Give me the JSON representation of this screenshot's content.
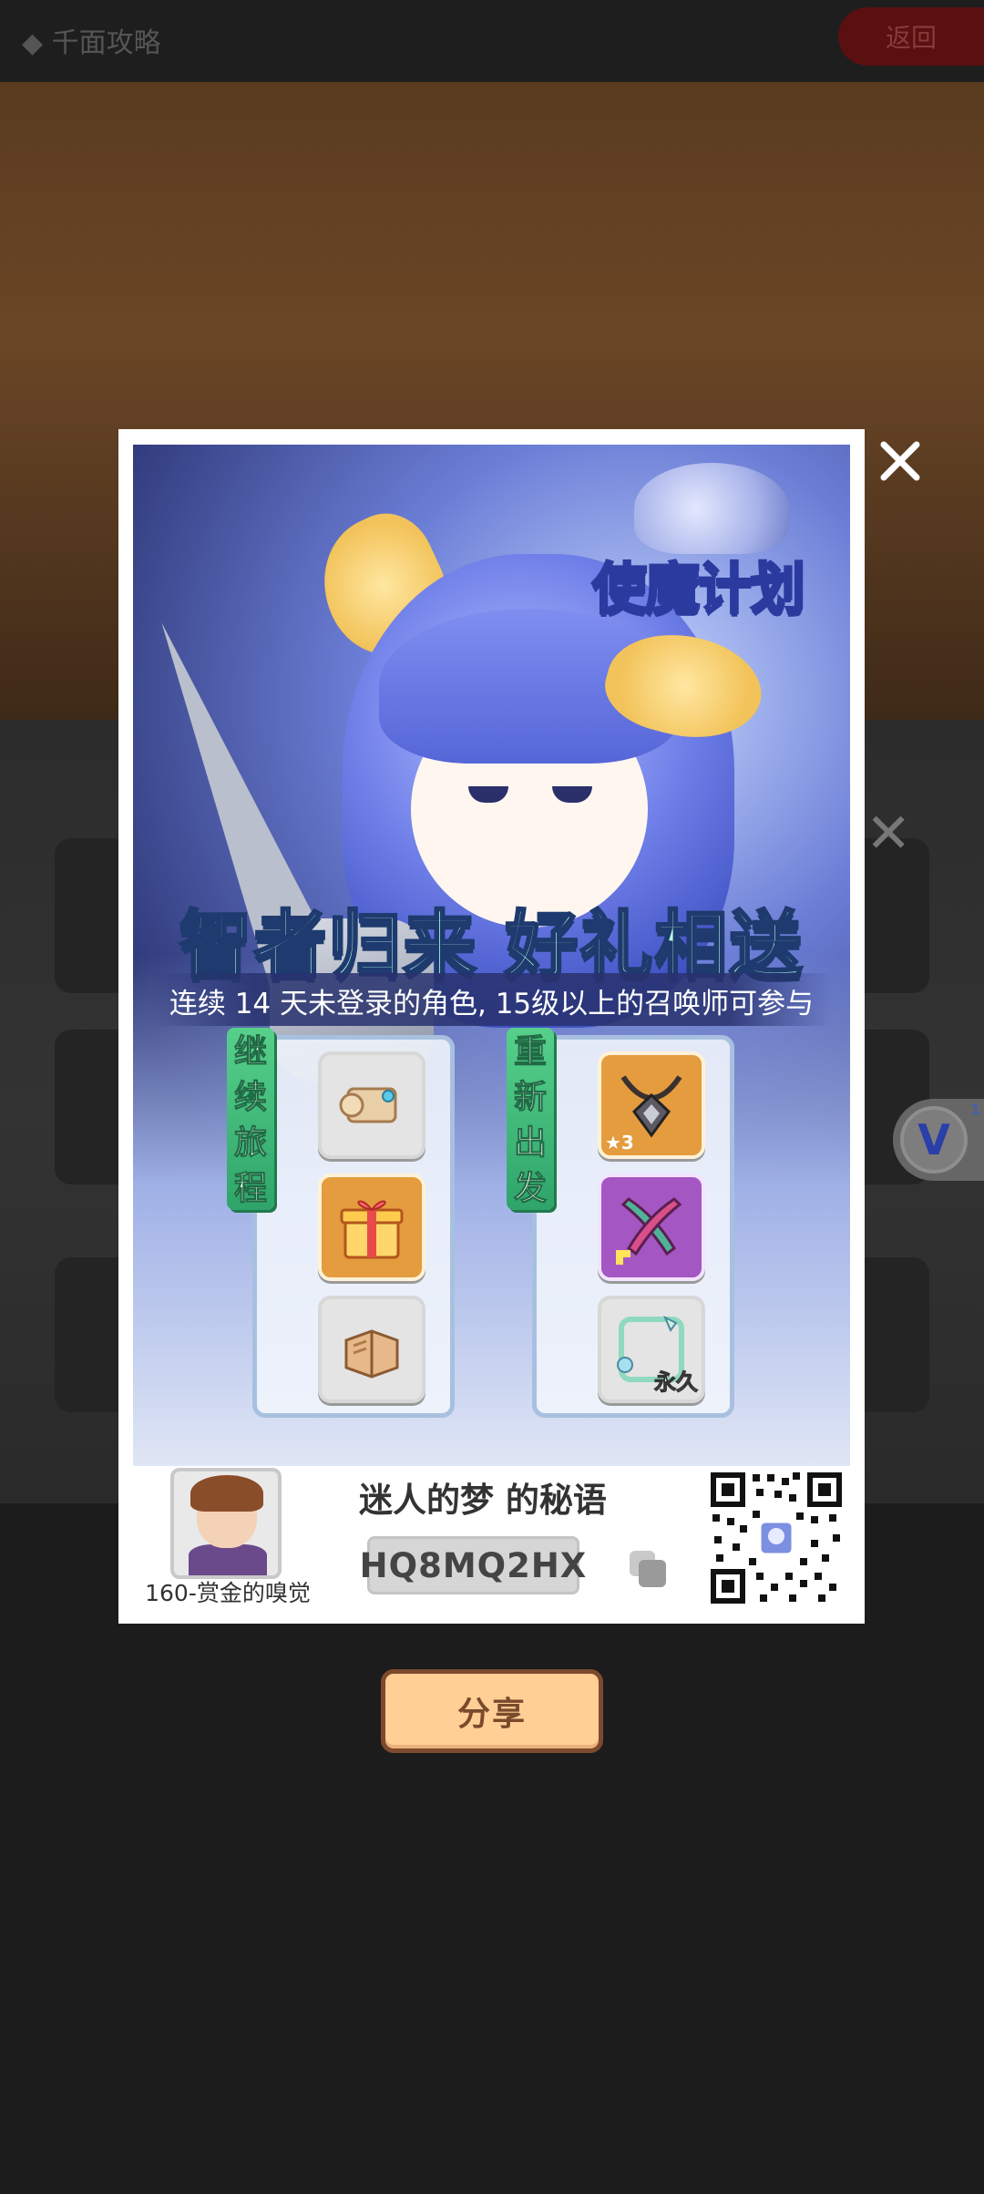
{
  "background": {
    "back_button_label": "返回",
    "title_text": "◆ 千面攻略",
    "close_glyph": "✕"
  },
  "floating_badge": {
    "letter": "V",
    "count": "1"
  },
  "poster": {
    "game_logo_text": "使魔计划",
    "headline": "智者归来 好礼相送",
    "subline": "连续 14 天未登录的角色, 15级以上的召唤师可参与",
    "left_ribbon": [
      "继",
      "续",
      "旅",
      "程"
    ],
    "right_ribbon": [
      "重",
      "新",
      "出",
      "发"
    ],
    "left_items": [
      {
        "icon": "scroll-icon"
      },
      {
        "icon": "gift-box-icon"
      },
      {
        "icon": "book-icon"
      }
    ],
    "right_items": [
      {
        "icon": "necklace-icon",
        "badge": "★3"
      },
      {
        "icon": "crossed-blades-icon"
      },
      {
        "icon": "avatar-frame-icon",
        "badge": "永久"
      }
    ]
  },
  "footer": {
    "player_name": "160-赏金的嗅觉",
    "secret_title": "迷人的梦 的秘语",
    "code": "HQ8MQ2HX"
  },
  "share_button_label": "分享",
  "colors": {
    "share_bg": "#ffcf96",
    "share_border": "#7d4a2e",
    "headline": "#b7ffe7",
    "ribbon": "#2fa46a"
  }
}
